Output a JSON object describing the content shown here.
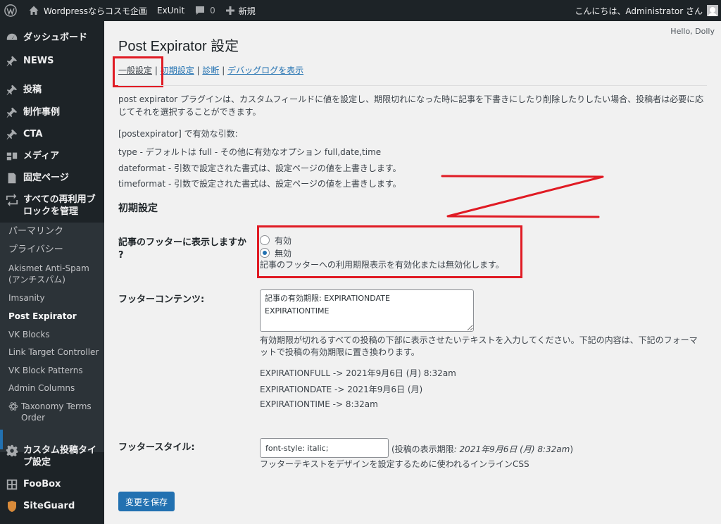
{
  "adminbar": {
    "site_name": "Wordpressならコスモ企画",
    "exunit": "ExUnit",
    "comments_count": "0",
    "new_label": "新規",
    "greeting": "こんにちは、Administrator さん"
  },
  "sidebar": {
    "items": [
      {
        "label": "ダッシュボード",
        "icon": "dashboard-icon"
      },
      {
        "label": "NEWS",
        "icon": "pin-icon"
      },
      {
        "label": "投稿",
        "icon": "pin-icon"
      },
      {
        "label": "制作事例",
        "icon": "pin-icon"
      },
      {
        "label": "CTA",
        "icon": "pin-icon"
      },
      {
        "label": "メディア",
        "icon": "media-icon"
      },
      {
        "label": "固定ページ",
        "icon": "page-icon"
      },
      {
        "label": "すべての再利用ブロックを管理",
        "icon": "reusable-block-icon"
      }
    ],
    "submenu": [
      "パーマリンク",
      "プライバシー",
      "Akismet Anti-Spam (アンチスパム)",
      "Imsanity",
      "Post Expirator",
      "VK Blocks",
      "Link Target Controller",
      "VK Block Patterns",
      "Admin Columns",
      "Taxonomy Terms Order"
    ],
    "bottom_items": [
      {
        "label": "カスタム投稿タイプ設定",
        "icon": "gear-icon"
      },
      {
        "label": "FooBox",
        "icon": "grid-icon"
      },
      {
        "label": "SiteGuard",
        "icon": "shield-icon"
      }
    ]
  },
  "main": {
    "hello_dolly": "Hello, Dolly",
    "title": "Post Expirator 設定",
    "tabs": [
      "一般設定",
      "初期設定",
      "診断",
      "デバッグログを表示"
    ],
    "tab_separator": " | ",
    "intro": "post expirator プラグインは、カスタムフィールドに値を設定し、期限切れになった時に記事を下書きにしたり削除したりしたい場合、投稿者は必要に応じてそれを選択することができます。",
    "args_heading": "[postexpirator] で有効な引数:",
    "args": [
      "type - デフォルトは full - その他に有効なオプション full,date,time",
      "dateformat - 引数で設定された書式は、設定ページの値を上書きします。",
      "timeformat - 引数で設定された書式は、設定ページの値を上書きします。"
    ],
    "section_title": "初期設定",
    "footer_display": {
      "label": "記事のフッターに表示しますか ?",
      "option_on": "有効",
      "option_off": "無効",
      "selected": "無効",
      "description": "記事のフッターへの利用期限表示を有効化または無効化します。"
    },
    "footer_contents": {
      "label": "フッターコンテンツ:",
      "value": "記事の有効期限: EXPIRATIONDATE\nEXPIRATIONTIME",
      "description": "有効期限が切れるすべての投稿の下部に表示させたいテキストを入力してください。下記の内容は、下記のフォーマットで投稿の有効期限に置き換わります。",
      "examples": [
        "EXPIRATIONFULL -> 2021年9月6日 (月) 8:32am",
        "EXPIRATIONDATE -> 2021年9月6日 (月)",
        "EXPIRATIONTIME -> 8:32am"
      ]
    },
    "footer_style": {
      "label": "フッタースタイル:",
      "value": "font-style: italic;",
      "preview_prefix": "(投稿の表示期限",
      "preview_italic": ": 2021年9月6日 (月) 8:32am",
      "preview_suffix": ")",
      "description": "フッターテキストをデザインを設定するために使われるインラインCSS"
    },
    "save_label": "変更を保存"
  },
  "colors": {
    "adminbar_bg": "#1d2327",
    "accent": "#2271b1",
    "annotation_red": "#e01b24"
  }
}
